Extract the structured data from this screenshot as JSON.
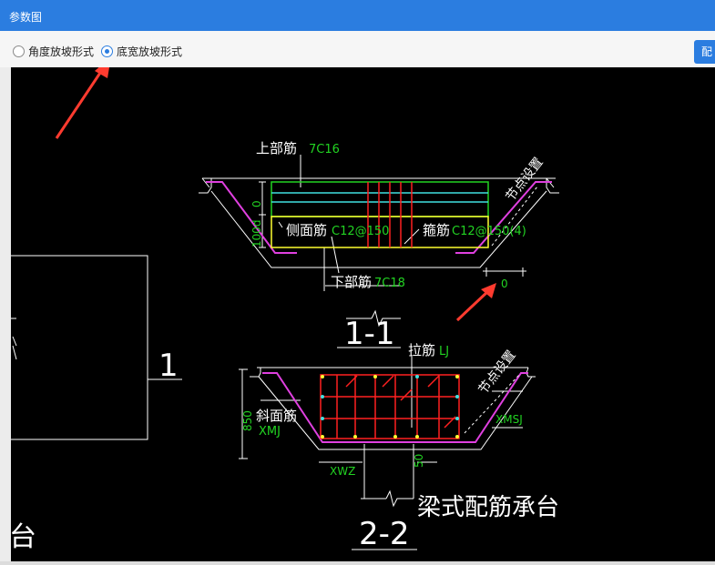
{
  "window": {
    "title": "参数图",
    "side_button": "配"
  },
  "options": [
    {
      "label": "角度放坡形式",
      "checked": false
    },
    {
      "label": "底宽放坡形式",
      "checked": true
    }
  ],
  "drawing": {
    "section1": {
      "top_bar_label": "上部筋",
      "top_bar_value": "7C16",
      "dim_left_top": "0",
      "dim_left_side": "100d",
      "side_bar_label": "侧面筋",
      "side_bar_value": "C12@150",
      "stirrup_label": "箍筋",
      "stirrup_value": "C12@150(4)",
      "bottom_bar_label": "下部筋",
      "bottom_bar_value": "7C18",
      "node_setting": "节点设置",
      "dim_right": "0",
      "section_title": "1-1"
    },
    "section2": {
      "tie_bar_label": "拉筋",
      "tie_bar_value": "LJ",
      "node_setting": "节点设置",
      "height_dim": "850",
      "slope_bar_label": "斜面筋",
      "slope_bar_value": "XMJ",
      "xmsj": "XMSJ",
      "xwz": "XWZ",
      "dim_50": "50",
      "section_title": "2-2"
    },
    "caption": "梁式配筋承台",
    "left_label_1": "1",
    "left_glyph": "台"
  },
  "colors": {
    "accent": "#2b7de0",
    "arrow": "#ff3b2f",
    "green": "#22d322",
    "cyan": "#40e0e0",
    "red": "#ff2020",
    "magenta": "#e040e0",
    "yellow": "#ffff30"
  }
}
